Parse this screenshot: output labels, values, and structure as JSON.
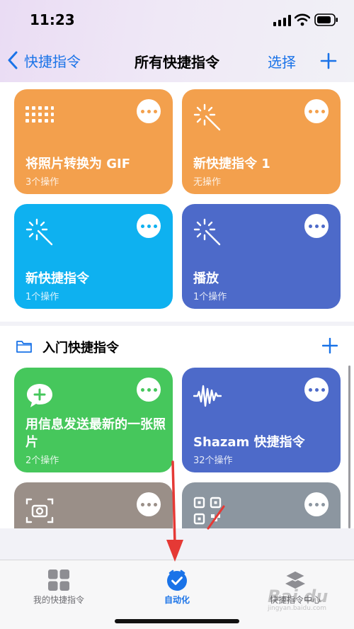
{
  "status_bar": {
    "time": "11:23"
  },
  "nav": {
    "back_label": "快捷指令",
    "title": "所有快捷指令",
    "select_label": "选择"
  },
  "shortcuts": [
    {
      "title": "将照片转换为 GIF",
      "subtitle": "3个操作",
      "color": "#f3a04d",
      "icon": "grid-dots-icon"
    },
    {
      "title": "新快捷指令 1",
      "subtitle": "无操作",
      "color": "#f3a04d",
      "icon": "magic-wand-icon"
    },
    {
      "title": "新快捷指令",
      "subtitle": "1个操作",
      "color": "#0eb1f0",
      "icon": "magic-wand-icon"
    },
    {
      "title": "播放",
      "subtitle": "1个操作",
      "color": "#4d6ac9",
      "icon": "magic-wand-icon"
    }
  ],
  "folder": {
    "title": "入门快捷指令",
    "shortcuts": [
      {
        "title": "用信息发送最新的一张照片",
        "subtitle": "2个操作",
        "color": "#46c75c",
        "icon": "message-plus-icon"
      },
      {
        "title": "Shazam 快捷指令",
        "subtitle": "32个操作",
        "color": "#4d6ac9",
        "icon": "waveform-icon"
      },
      {
        "title": "",
        "subtitle": "",
        "color": "#9a8f88",
        "icon": "camera-scan-icon"
      },
      {
        "title": "",
        "subtitle": "",
        "color": "#8c96a0",
        "icon": "qr-code-icon"
      }
    ]
  },
  "tabs": [
    {
      "label": "我的快捷指令",
      "icon": "grid-icon",
      "active": false
    },
    {
      "label": "自动化",
      "icon": "clock-check-icon",
      "active": true
    },
    {
      "label": "快捷指令中心",
      "icon": "stack-layers-icon",
      "active": false
    }
  ],
  "watermark": {
    "text": "Bai du",
    "sub": "jingyan.baidu.com"
  },
  "colors": {
    "accent": "#1a73e8",
    "annotation": "#e53935"
  }
}
